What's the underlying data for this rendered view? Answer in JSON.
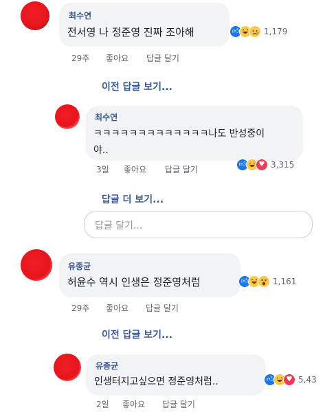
{
  "comments": [
    {
      "author": "최수연",
      "text": "전서영 나 정준영 진짜 조아해",
      "reactions": [
        "like",
        "haha",
        "sad"
      ],
      "count": "1,179",
      "time": "29주",
      "like_label": "좋아요",
      "reply_label": "답글 달기"
    },
    {
      "author": "최수연",
      "text_line1": "ㅋㅋㅋㅋㅋㅋㅋㅋㅋㅋㅋㅋㅋ나도 반성중이",
      "text_line2": "야..",
      "reactions": [
        "like",
        "haha",
        "love"
      ],
      "count": "3,315",
      "time": "3일",
      "like_label": "좋아요",
      "reply_label": "답글 달기"
    },
    {
      "author": "유종균",
      "text": "허윤수 역시 인생은 정준영처럼",
      "reactions": [
        "like",
        "haha",
        "wow"
      ],
      "count": "1,161",
      "time": "29주",
      "like_label": "좋아요",
      "reply_label": "답글 달기"
    },
    {
      "author": "유종균",
      "text": "인생터지고싶으면 정준영처럼..",
      "reactions": [
        "like",
        "haha",
        "love"
      ],
      "count": "5,43",
      "time": "2일",
      "like_label": "좋아요",
      "reply_label": "답글 달기"
    }
  ],
  "links": {
    "prev_replies_1": "이전 답글 보기...",
    "more_replies": "답글 더 보기...",
    "prev_replies_2": "이전 답글 보기..."
  },
  "reply_input": {
    "placeholder": "답글 달기..."
  },
  "colors": {
    "link": "#385898",
    "bubble": "#f2f3f5",
    "avatar_blot": "#e8141a"
  }
}
